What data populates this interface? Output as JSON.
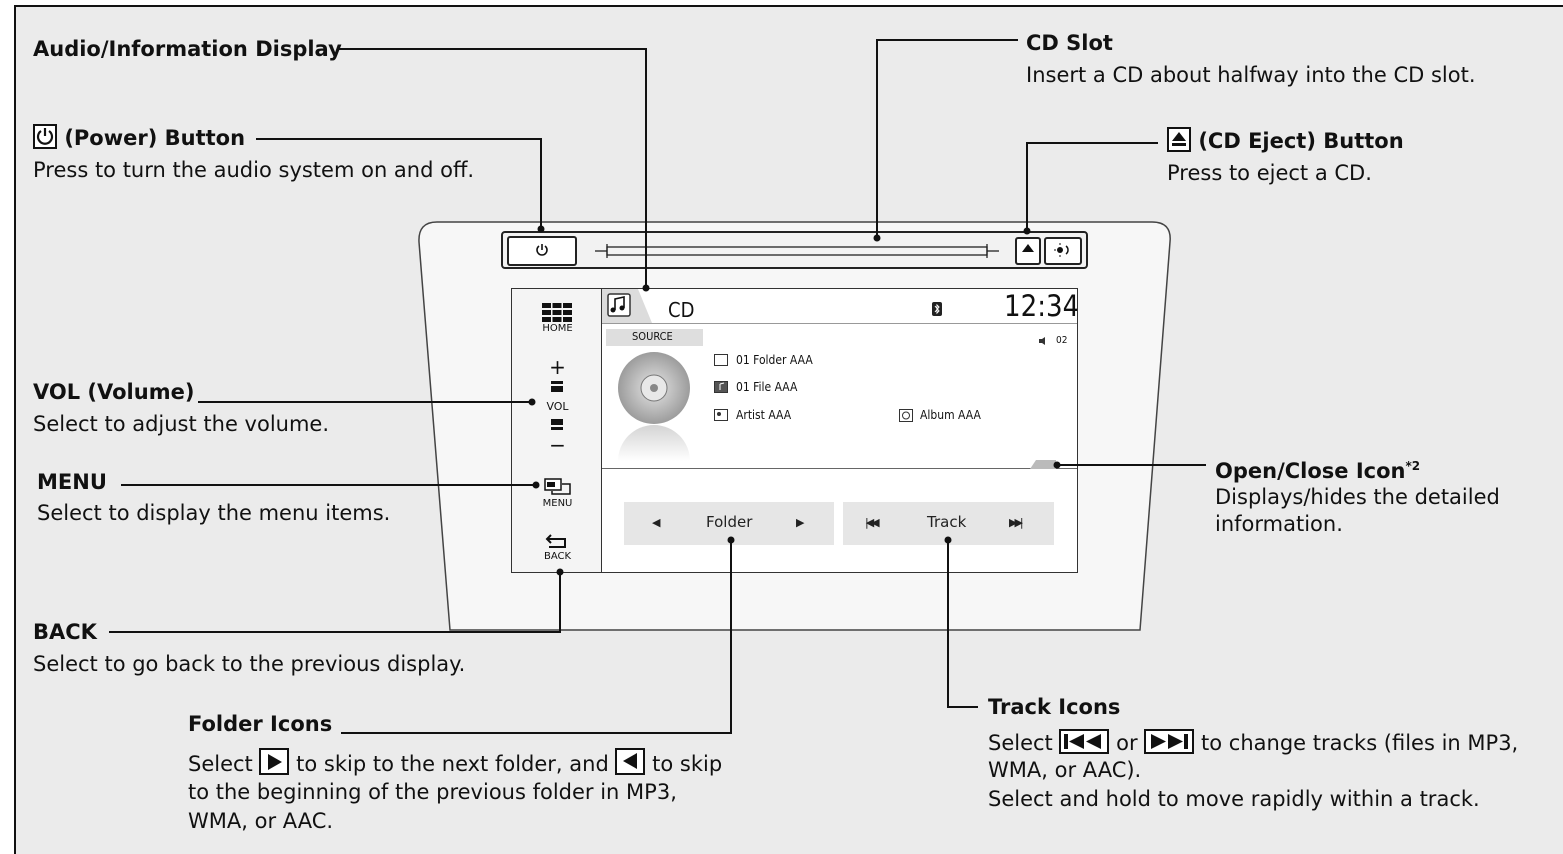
{
  "labels": {
    "audio_display": "Audio/Information Display",
    "power_title": "(Power) Button",
    "power_desc": "Press to turn the audio system on and off.",
    "cd_slot_title": "CD Slot",
    "cd_slot_desc": "Insert a CD about halfway into the CD slot.",
    "eject_title": "(CD Eject) Button",
    "eject_desc": "Press to eject a CD.",
    "vol_title": "VOL (Volume)",
    "vol_desc": "Select to adjust the volume.",
    "menu_title": "MENU",
    "menu_desc": "Select to display the menu items.",
    "back_title": "BACK",
    "back_desc": "Select to go back to the previous display.",
    "openclose_title": "Open/Close Icon",
    "openclose_sup": "*2",
    "openclose_desc1": "Displays/hides the detailed",
    "openclose_desc2": "information.",
    "folder_title": "Folder Icons",
    "folder_desc1a": "Select",
    "folder_desc1b": "to skip to the next folder, and",
    "folder_desc1c": "to skip",
    "folder_desc2": "to the beginning of the previous folder in MP3,",
    "folder_desc3": "WMA, or AAC.",
    "track_title": "Track Icons",
    "track_desc1a": "Select",
    "track_desc1b": "or",
    "track_desc1c": "to change tracks (files in MP3,",
    "track_desc2": "WMA, or AAC).",
    "track_desc3": "Select and hold to move rapidly within a track."
  },
  "unit": {
    "side": {
      "home": "HOME",
      "vol_plus": "+",
      "vol": "VOL",
      "vol_minus": "−",
      "menu": "MENU",
      "back": "BACK"
    },
    "screen": {
      "source_name": "CD",
      "clock": "12:34",
      "source_label": "SOURCE",
      "track_number": "02",
      "folder": "01 Folder AAA",
      "file": "01 File AAA",
      "artist": "Artist AAA",
      "album": "Album AAA",
      "folder_ctrl": "Folder",
      "track_ctrl": "Track"
    }
  },
  "icons": {
    "power": "power-icon",
    "eject": "eject-icon",
    "next_folder": "play-right-icon",
    "prev_folder": "play-left-icon",
    "skip_back": "skip-back-icon",
    "skip_forward": "skip-forward-icon",
    "music_note": "music-note-icon",
    "bluetooth": "bluetooth-icon",
    "disc": "cd-disc-icon"
  }
}
